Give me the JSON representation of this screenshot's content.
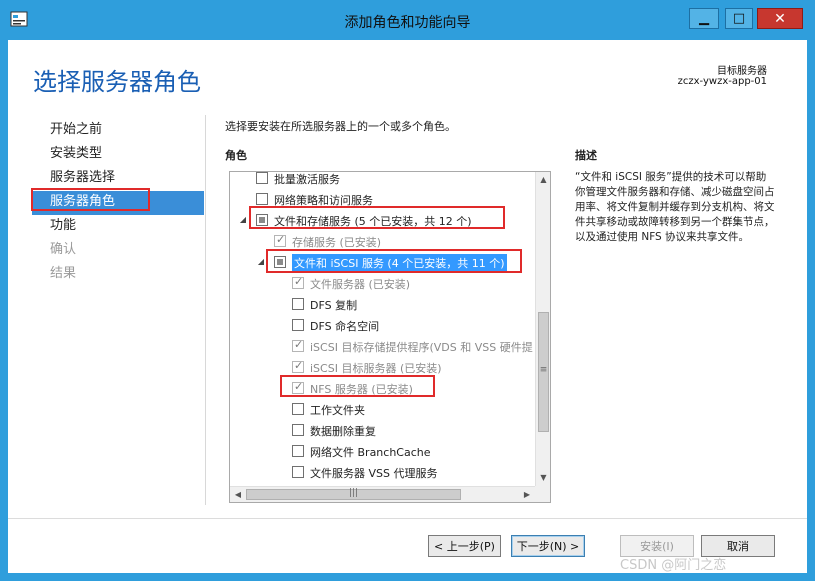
{
  "window": {
    "title": "添加角色和功能向导"
  },
  "header": {
    "page_title": "选择服务器角色",
    "target_label": "目标服务器",
    "target_value": "zczx-ywzx-app-01"
  },
  "nav": {
    "items": [
      {
        "label": "开始之前",
        "state": "normal"
      },
      {
        "label": "安装类型",
        "state": "normal"
      },
      {
        "label": "服务器选择",
        "state": "normal"
      },
      {
        "label": "服务器角色",
        "state": "active"
      },
      {
        "label": "功能",
        "state": "normal"
      },
      {
        "label": "确认",
        "state": "disabled"
      },
      {
        "label": "结果",
        "state": "disabled"
      }
    ]
  },
  "main": {
    "intro": "选择要安装在所选服务器上的一个或多个角色。",
    "roles_heading": "角色",
    "description_heading": "描述",
    "description_text": "“文件和 iSCSI 服务”提供的技术可以帮助你管理文件服务器和存储、减少磁盘空间占用率、将文件复制并缓存到分支机构、将文件共享移动或故障转移到另一个群集节点，以及通过使用 NFS 协议来共享文件。"
  },
  "roles_tree": [
    {
      "label": "批量激活服务",
      "check": "none",
      "expander": "",
      "grey": false,
      "selected": false
    },
    {
      "label": "网络策略和访问服务",
      "check": "none",
      "expander": "",
      "grey": false,
      "selected": false
    },
    {
      "label": "文件和存储服务 (5 个已安装，共 12 个)",
      "check": "partial",
      "expander": "◢",
      "grey": false,
      "selected": false
    },
    {
      "label": "存储服务 (已安装)",
      "check": "checked",
      "expander": "",
      "grey": true,
      "selected": false
    },
    {
      "label": "文件和 iSCSI 服务 (4 个已安装，共 11 个)",
      "check": "partial",
      "expander": "◢",
      "grey": false,
      "selected": true
    },
    {
      "label": "文件服务器 (已安装)",
      "check": "checked",
      "expander": "",
      "grey": true,
      "selected": false
    },
    {
      "label": "DFS 复制",
      "check": "none",
      "expander": "",
      "grey": false,
      "selected": false
    },
    {
      "label": "DFS 命名空间",
      "check": "none",
      "expander": "",
      "grey": false,
      "selected": false
    },
    {
      "label": "iSCSI 目标存储提供程序(VDS 和 VSS 硬件提",
      "check": "checked",
      "expander": "",
      "grey": true,
      "selected": false
    },
    {
      "label": "iSCSI 目标服务器 (已安装)",
      "check": "checked",
      "expander": "",
      "grey": true,
      "selected": false
    },
    {
      "label": "NFS 服务器 (已安装)",
      "check": "checked",
      "expander": "",
      "grey": true,
      "selected": false
    },
    {
      "label": "工作文件夹",
      "check": "none",
      "expander": "",
      "grey": false,
      "selected": false
    },
    {
      "label": "数据删除重复",
      "check": "none",
      "expander": "",
      "grey": false,
      "selected": false
    },
    {
      "label": "网络文件 BranchCache",
      "check": "none",
      "expander": "",
      "grey": false,
      "selected": false
    },
    {
      "label": "文件服务器 VSS 代理服务",
      "check": "none",
      "expander": "",
      "grey": false,
      "selected": false
    }
  ],
  "buttons": {
    "prev": "< 上一步(P)",
    "next": "下一步(N) >",
    "install": "安装(I)",
    "cancel": "取消"
  },
  "watermark": "CSDN @阿门之恋",
  "icons": {
    "app": "server-manager-icon",
    "minimize": "minimize-icon",
    "maximize": "maximize-icon",
    "close": "close-icon"
  },
  "colors": {
    "titlebar": "#2f9edc",
    "accent": "#3a8ed8",
    "annotation": "#e02a2a"
  }
}
